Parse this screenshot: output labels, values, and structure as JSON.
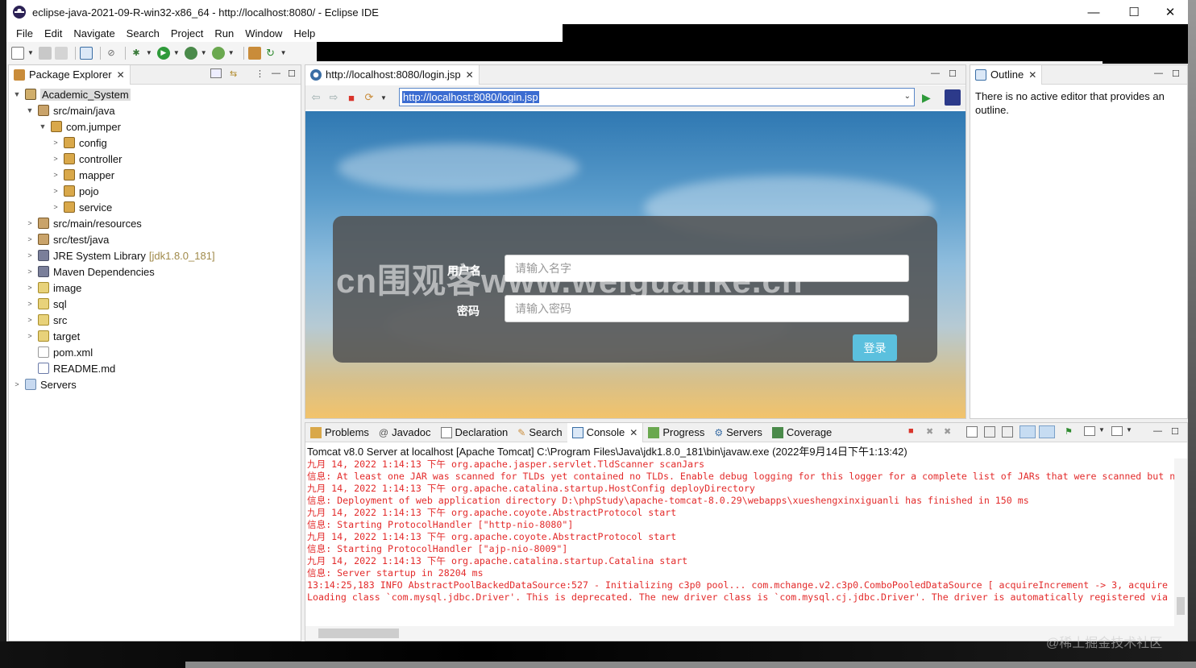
{
  "window": {
    "title": "eclipse-java-2021-09-R-win32-x86_64 - http://localhost:8080/ - Eclipse IDE",
    "minimize": "—",
    "maximize": "☐",
    "close": "✕"
  },
  "menu": [
    "File",
    "Edit",
    "Navigate",
    "Search",
    "Project",
    "Run",
    "Window",
    "Help"
  ],
  "package_explorer": {
    "tab": "Package Explorer",
    "items": [
      {
        "label": "Academic_System",
        "icon": "project-icon"
      },
      {
        "label": "src/main/java",
        "icon": "source-folder-icon"
      },
      {
        "label": "com.jumper",
        "icon": "package-icon"
      },
      {
        "label": "config",
        "icon": "package-icon"
      },
      {
        "label": "controller",
        "icon": "package-icon"
      },
      {
        "label": "mapper",
        "icon": "package-icon"
      },
      {
        "label": "pojo",
        "icon": "package-icon"
      },
      {
        "label": "service",
        "icon": "package-icon"
      },
      {
        "label": "src/main/resources",
        "icon": "source-folder-icon"
      },
      {
        "label": "src/test/java",
        "icon": "source-folder-icon"
      },
      {
        "label": "JRE System Library",
        "decoration": "[jdk1.8.0_181]",
        "icon": "library-icon"
      },
      {
        "label": "Maven Dependencies",
        "icon": "library-icon"
      },
      {
        "label": "image",
        "icon": "folder-icon"
      },
      {
        "label": "sql",
        "icon": "folder-icon"
      },
      {
        "label": "src",
        "icon": "folder-icon"
      },
      {
        "label": "target",
        "icon": "folder-icon"
      },
      {
        "label": "pom.xml",
        "icon": "xml-file-icon"
      },
      {
        "label": "README.md",
        "icon": "markdown-file-icon"
      },
      {
        "label": "Servers",
        "icon": "servers-folder-icon"
      }
    ]
  },
  "browser": {
    "tab": "http://localhost:8080/login.jsp",
    "url": "http://localhost:8080/login.jsp",
    "login": {
      "username_label": "用户名",
      "username_placeholder": "请输入名字",
      "password_label": "密码",
      "password_placeholder": "请输入密码",
      "submit": "登录"
    },
    "watermark": "cn围观客www.weiguanke.cn"
  },
  "outline": {
    "tab": "Outline",
    "message": "There is no active editor that provides an outline."
  },
  "bottom_tabs": [
    "Problems",
    "Javadoc",
    "Declaration",
    "Search",
    "Console",
    "Progress",
    "Servers",
    "Coverage"
  ],
  "console": {
    "header": "Tomcat v8.0 Server at localhost [Apache Tomcat] C:\\Program Files\\Java\\jdk1.8.0_181\\bin\\javaw.exe  (2022年9月14日下午1:13:42)",
    "lines": [
      "九月 14, 2022 1:14:13 下午 org.apache.jasper.servlet.TldScanner scanJars",
      "信息: At least one JAR was scanned for TLDs yet contained no TLDs. Enable debug logging for this logger for a complete list of JARs that were scanned but no",
      "九月 14, 2022 1:14:13 下午 org.apache.catalina.startup.HostConfig deployDirectory",
      "信息: Deployment of web application directory D:\\phpStudy\\apache-tomcat-8.0.29\\webapps\\xueshengxinxiguanli has finished in 150 ms",
      "九月 14, 2022 1:14:13 下午 org.apache.coyote.AbstractProtocol start",
      "信息: Starting ProtocolHandler [\"http-nio-8080\"]",
      "九月 14, 2022 1:14:13 下午 org.apache.coyote.AbstractProtocol start",
      "信息: Starting ProtocolHandler [\"ajp-nio-8009\"]",
      "九月 14, 2022 1:14:13 下午 org.apache.catalina.startup.Catalina start",
      "信息: Server startup in 28204 ms",
      "13:14:25,183  INFO AbstractPoolBackedDataSource:527 - Initializing c3p0 pool... com.mchange.v2.c3p0.ComboPooledDataSource [ acquireIncrement -> 3, acquire",
      "Loading class `com.mysql.jdbc.Driver'. This is deprecated. The new driver class is `com.mysql.cj.jdbc.Driver'. The driver is automatically registered via"
    ]
  },
  "corner_watermark": "@稀土掘金技术社区",
  "colors": {
    "console_text": "#e32b2b",
    "login_button": "#5bc0de",
    "url_selection": "#3b6cd1"
  }
}
